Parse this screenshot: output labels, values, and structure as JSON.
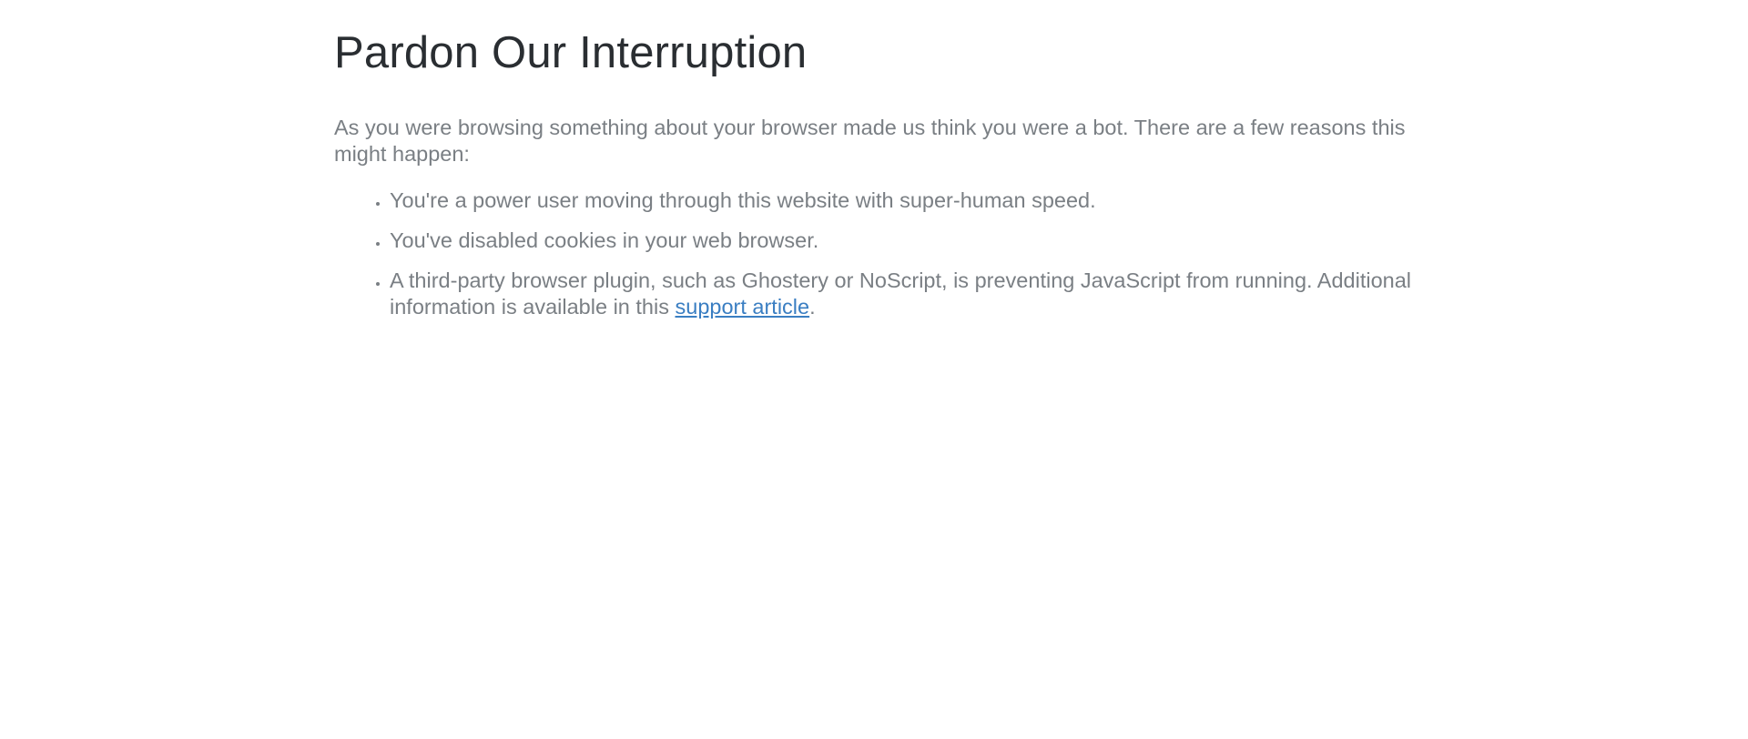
{
  "page": {
    "title": "Pardon Our Interruption",
    "intro": "As you were browsing something about your browser made us think you were a bot. There are a few reasons this might happen:",
    "reasons": [
      "You're a power user moving through this website with super-human speed.",
      "You've disabled cookies in your web browser.",
      "A third-party browser plugin, such as Ghostery or NoScript, is preventing JavaScript from running. Additional information is available in this "
    ],
    "support_link_label": "support article",
    "trailing_period": "."
  },
  "colors": {
    "title": "#2a2e32",
    "body_text": "#7a7f84",
    "link": "#3a7ec2",
    "background": "#ffffff"
  }
}
